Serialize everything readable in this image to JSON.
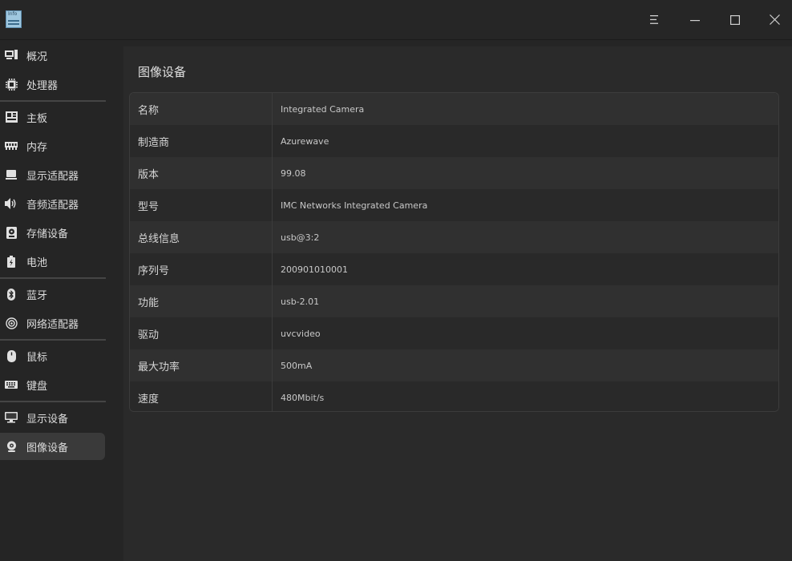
{
  "window": {
    "app_icon_text": "Info",
    "controls": [
      "menu",
      "minimize",
      "maximize",
      "close"
    ]
  },
  "sidebar": {
    "items": [
      {
        "label": "概况",
        "icon": "overview-icon"
      },
      {
        "label": "处理器",
        "icon": "cpu-icon"
      },
      {
        "label": "主板",
        "icon": "motherboard-icon"
      },
      {
        "label": "内存",
        "icon": "memory-icon"
      },
      {
        "label": "显示适配器",
        "icon": "display-adapter-icon"
      },
      {
        "label": "音频适配器",
        "icon": "audio-adapter-icon"
      },
      {
        "label": "存储设备",
        "icon": "storage-icon"
      },
      {
        "label": "电池",
        "icon": "battery-icon"
      },
      {
        "label": "蓝牙",
        "icon": "bluetooth-icon"
      },
      {
        "label": "网络适配器",
        "icon": "network-icon"
      },
      {
        "label": "鼠标",
        "icon": "mouse-icon"
      },
      {
        "label": "键盘",
        "icon": "keyboard-icon"
      },
      {
        "label": "显示设备",
        "icon": "monitor-icon"
      },
      {
        "label": "图像设备",
        "icon": "camera-icon"
      }
    ],
    "active_index": 13
  },
  "main": {
    "title": "图像设备",
    "rows": [
      {
        "key": "名称",
        "value": "Integrated Camera"
      },
      {
        "key": "制造商",
        "value": "Azurewave"
      },
      {
        "key": "版本",
        "value": "99.08"
      },
      {
        "key": "型号",
        "value": "IMC Networks Integrated Camera"
      },
      {
        "key": "总线信息",
        "value": "usb@3:2"
      },
      {
        "key": "序列号",
        "value": "200901010001"
      },
      {
        "key": "功能",
        "value": "usb-2.01"
      },
      {
        "key": "驱动",
        "value": "uvcvideo"
      },
      {
        "key": "最大功率",
        "value": "500mA"
      },
      {
        "key": "速度",
        "value": "480Mbit/s"
      }
    ]
  },
  "colors": {
    "background": "#252525",
    "panel": "#2a2a2a",
    "row_odd": "#303030",
    "row_even": "#292929",
    "active_item": "#3a3a3a"
  }
}
